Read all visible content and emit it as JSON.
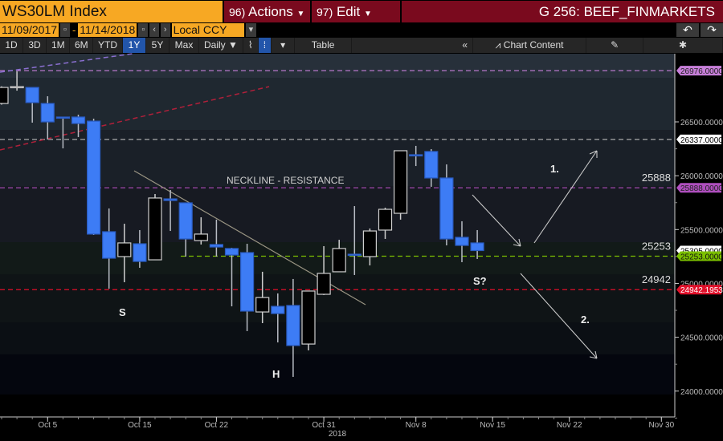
{
  "header": {
    "title": "WS30LM Index",
    "actions_num": "96)",
    "actions_label": "Actions",
    "edit_num": "97)",
    "edit_label": "Edit",
    "page_title": "G 256: BEEF_FINMARKETS"
  },
  "range": {
    "start": "11/09/2017",
    "end": "11/14/2018",
    "currency": "Local CCY"
  },
  "toolbar": {
    "periods": [
      "1D",
      "3D",
      "1M",
      "6M",
      "YTD",
      "1Y",
      "5Y",
      "Max"
    ],
    "selected": "1Y",
    "frequency": "Daily ▼",
    "table": "Table",
    "collapse": "«",
    "chart_content": "Chart Content"
  },
  "colors": {
    "up_body": "#000000",
    "up_outline": "#cfcfcf",
    "down_body": "#3d7cf5",
    "accent": "#f7a823",
    "header_red": "#7a0a1e"
  },
  "chart_data": {
    "type": "candlestick",
    "ylim": [
      23850,
      27150
    ],
    "yticks": [
      "24000.0000",
      "24500.0000",
      "25000.0000",
      "25500.0000",
      "26000.0000",
      "26500.0000"
    ],
    "xticks": [
      {
        "label": "Oct 5",
        "date": "2018-10-05"
      },
      {
        "label": "Oct 15",
        "date": "2018-10-15"
      },
      {
        "label": "Oct 22",
        "date": "2018-10-22"
      },
      {
        "label": "Oct 31",
        "date": "2018-10-31"
      },
      {
        "label": "Nov 8",
        "date": "2018-11-08"
      },
      {
        "label": "Nov 15",
        "date": "2018-11-15"
      },
      {
        "label": "Nov 22",
        "date": "2018-11-22"
      },
      {
        "label": "Nov 30",
        "date": "2018-11-30"
      }
    ],
    "year_label": "2018",
    "candles": [
      [
        "2018-10-02",
        26671,
        26830,
        26660,
        26820
      ],
      [
        "2018-10-03",
        26820,
        26969,
        26790,
        26828
      ],
      [
        "2018-10-04",
        26820,
        26820,
        26493,
        26679
      ],
      [
        "2018-10-05",
        26671,
        26738,
        26336,
        26500
      ],
      [
        "2018-10-08",
        26545,
        26545,
        26254,
        26540
      ],
      [
        "2018-10-09",
        26545,
        26567,
        26359,
        26485
      ],
      [
        "2018-10-10",
        26507,
        26530,
        25450,
        25458
      ],
      [
        "2018-10-11",
        25480,
        25696,
        24951,
        25234
      ],
      [
        "2018-10-12",
        25249,
        25554,
        25011,
        25376
      ],
      [
        "2018-10-15",
        25368,
        25495,
        25145,
        25204
      ],
      [
        "2018-10-16",
        25219,
        25830,
        25219,
        25793
      ],
      [
        "2018-10-17",
        25785,
        25867,
        25487,
        25770
      ],
      [
        "2018-10-18",
        25748,
        25748,
        25249,
        25413
      ],
      [
        "2018-10-19",
        25398,
        25614,
        25361,
        25458
      ],
      [
        "2018-10-22",
        25361,
        25592,
        25249,
        25338
      ],
      [
        "2018-10-23",
        25324,
        25331,
        24787,
        25264
      ],
      [
        "2018-10-24",
        25286,
        25368,
        24557,
        24743
      ],
      [
        "2018-10-25",
        24735,
        25108,
        24631,
        24869
      ],
      [
        "2018-10-26",
        24787,
        24907,
        24452,
        24720
      ],
      [
        "2018-10-29",
        24795,
        25041,
        24132,
        24423
      ],
      [
        "2018-10-30",
        24437,
        24929,
        24378,
        24929
      ],
      [
        "2018-10-31",
        24899,
        25346,
        24892,
        25093
      ],
      [
        "2018-11-01",
        25108,
        25405,
        25108,
        25324
      ],
      [
        "2018-11-02",
        25271,
        25718,
        25078,
        25268
      ],
      [
        "2018-11-05",
        25249,
        25510,
        25167,
        25487
      ],
      [
        "2018-11-06",
        25495,
        25703,
        25413,
        25688
      ],
      [
        "2018-11-07",
        25651,
        26232,
        25592,
        26232
      ],
      [
        "2018-11-08",
        26195,
        26277,
        26090,
        26190
      ],
      [
        "2018-11-09",
        26225,
        26247,
        25897,
        25979
      ],
      [
        "2018-11-12",
        25979,
        26105,
        25353,
        25413
      ],
      [
        "2018-11-13",
        25428,
        25577,
        25197,
        25353
      ],
      [
        "2018-11-14",
        25376,
        25495,
        25227,
        25305
      ]
    ],
    "levels": [
      {
        "value": 26976,
        "tag": "26976.0000",
        "color": "#c77fd9",
        "text": "#222"
      },
      {
        "value": 26337,
        "tag": "26337.0000",
        "color": "#ffffff",
        "text": "#000"
      },
      {
        "value": 25888,
        "tag": "25888.0000",
        "color": "#b04fbf",
        "text": "#222",
        "label": "25888"
      },
      {
        "value": 25305,
        "tag": "25305.0000",
        "color": "#ffffff",
        "text": "#000",
        "noline": true
      },
      {
        "value": 25253,
        "tag": "25253.0000",
        "color": "#7cc000",
        "text": "#111",
        "label": "25253"
      },
      {
        "value": 24942.1953,
        "tag": "24942.1953",
        "color": "#e0102a",
        "text": "#fff",
        "label": "24942"
      }
    ],
    "annotations": {
      "neckline": "NECKLINE - RESISTANCE",
      "left_shoulder": "S",
      "head": "H",
      "right_shoulder": "S?",
      "scenario1": "1.",
      "scenario2": "2."
    }
  }
}
